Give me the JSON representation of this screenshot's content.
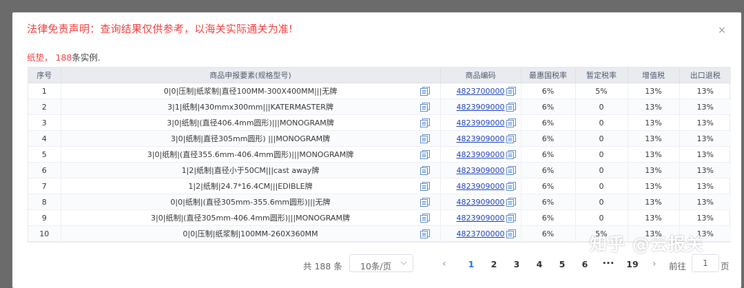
{
  "dialog": {
    "title": "法律免责声明：查询结果仅供参考，以海关实际通关为准!",
    "close_symbol": "×"
  },
  "summary": {
    "keyword": "纸垫",
    "sep": "，",
    "count": "188",
    "suffix": "条实例."
  },
  "table": {
    "headers": [
      "序号",
      "商品申报要素(规格型号)",
      "商品编码",
      "最惠国税率",
      "暂定税率",
      "增值税",
      "出口退税"
    ],
    "rows": [
      {
        "no": "1",
        "spec": "0|0|压制|纸浆制|直径100MM-300X400MM|||无牌",
        "code": "4823700000",
        "mfn": "6%",
        "provisional": "5%",
        "vat": "13%",
        "rebate": "13%"
      },
      {
        "no": "2",
        "spec": "3|1|纸制|430mmx300mm|||KATERMASTER牌",
        "code": "4823909000",
        "mfn": "6%",
        "provisional": "0",
        "vat": "13%",
        "rebate": "13%"
      },
      {
        "no": "3",
        "spec": "3|0|纸制|(直径406.4mm圆形)|||MONOGRAM牌",
        "code": "4823909000",
        "mfn": "6%",
        "provisional": "0",
        "vat": "13%",
        "rebate": "13%"
      },
      {
        "no": "4",
        "spec": "3|0|纸制|直径305mm圆形) |||MONOGRAM牌",
        "code": "4823909000",
        "mfn": "6%",
        "provisional": "0",
        "vat": "13%",
        "rebate": "13%"
      },
      {
        "no": "5",
        "spec": "3|0|纸制|(直径355.6mm-406.4mm圆形)|||MONOGRAM牌",
        "code": "4823909000",
        "mfn": "6%",
        "provisional": "0",
        "vat": "13%",
        "rebate": "13%"
      },
      {
        "no": "6",
        "spec": "1|2|纸制|直径小于50CM|||cast away牌",
        "code": "4823909000",
        "mfn": "6%",
        "provisional": "0",
        "vat": "13%",
        "rebate": "13%"
      },
      {
        "no": "7",
        "spec": "1|2|纸制|24.7*16.4CM|||EDIBLE牌",
        "code": "4823909000",
        "mfn": "6%",
        "provisional": "0",
        "vat": "13%",
        "rebate": "13%"
      },
      {
        "no": "8",
        "spec": "0|0|纸制|(直径305mm-355.6mm圆形)|||无牌",
        "code": "4823909000",
        "mfn": "6%",
        "provisional": "0",
        "vat": "13%",
        "rebate": "13%"
      },
      {
        "no": "9",
        "spec": "3|0|纸制|(直径305mm-406.4mm圆形)|||MONOGRAM牌",
        "code": "4823909000",
        "mfn": "6%",
        "provisional": "0",
        "vat": "13%",
        "rebate": "13%"
      },
      {
        "no": "10",
        "spec": "0|0|压制|纸浆制|100MM-260X360MM",
        "code": "4823700000",
        "mfn": "6%",
        "provisional": "5%",
        "vat": "13%",
        "rebate": "13%"
      }
    ]
  },
  "pagination": {
    "total": "共 188 条",
    "page_size": "10条/页",
    "prev_symbol": "‹",
    "next_symbol": "›",
    "pages": [
      "1",
      "2",
      "3",
      "4",
      "5",
      "6"
    ],
    "ellipsis": "•••",
    "last_page": "19",
    "goto_prefix": "前往",
    "goto_value": "1",
    "goto_suffix": "页"
  },
  "watermark": "知乎 @云报关",
  "colors": {
    "warning_red": "#f23d3d",
    "link_blue": "#1a3fbf",
    "active_page": "#1a73e8",
    "header_bg": "#e9ebef"
  },
  "icons": {
    "copy": "copy-icon",
    "close": "close-icon",
    "dropdown": "chevron-down-icon"
  }
}
